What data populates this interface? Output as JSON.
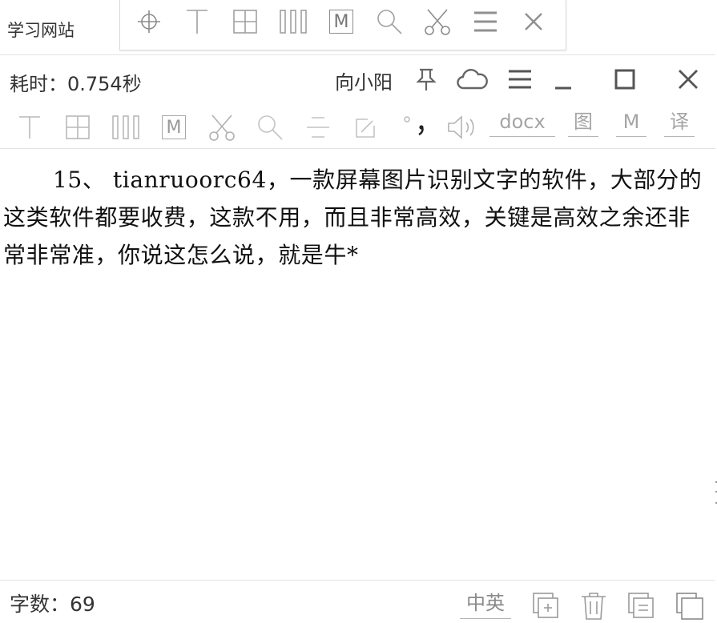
{
  "background": {
    "window_label": "学习网站"
  },
  "floating_toolbar": {
    "icons": [
      "crosshair-icon",
      "text-cursor-icon",
      "table-icon",
      "columns-icon",
      "markdown-icon",
      "search-icon",
      "scissors-icon",
      "menu-icon",
      "close-icon"
    ],
    "markdown_label": "M"
  },
  "window": {
    "elapsed": "耗时：0.754秒",
    "username": "向小阳",
    "title_icons": [
      "pin-icon",
      "cloud-icon",
      "menu-icon",
      "minimize-icon",
      "maximize-icon",
      "close-icon"
    ]
  },
  "toolbar": {
    "markdown_label": "M",
    "docx_label": "docx",
    "image_label": "图",
    "m_label": "M",
    "translate_label": "译"
  },
  "content": {
    "text": "15、 tianruoorc64，一款屏幕图片识别文字的软件，大部分的这类软件都要收费，这款不用，而且非常高效，关键是高效之余还非常非常准，你说这怎么说，就是牛*"
  },
  "statusbar": {
    "char_count": "字数：69",
    "lang_toggle": "中英"
  }
}
